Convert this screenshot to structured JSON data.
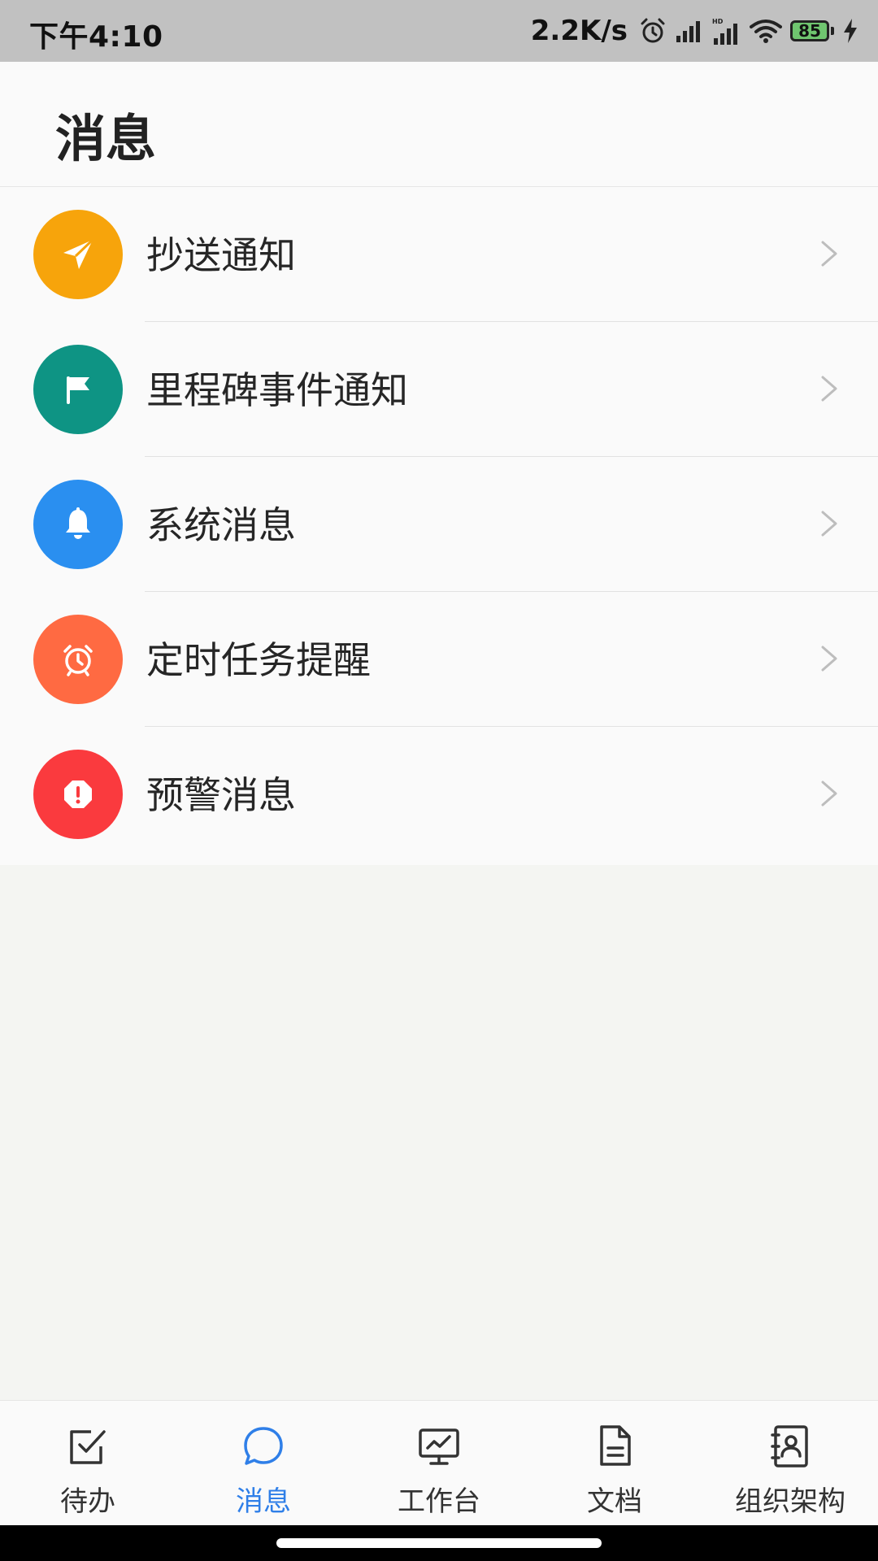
{
  "status_bar": {
    "time": "下午4:10",
    "net_speed": "2.2K/s",
    "battery_level": "85",
    "icons": [
      "alarm-icon",
      "signal-icon",
      "signal-hd-icon",
      "wifi-icon",
      "battery-icon",
      "charging-icon"
    ]
  },
  "header": {
    "title": "消息"
  },
  "list": {
    "items": [
      {
        "label": "抄送通知",
        "icon": "paper-plane-icon",
        "color": "#f7a40b"
      },
      {
        "label": "里程碑事件通知",
        "icon": "flag-icon",
        "color": "#0e9484"
      },
      {
        "label": "系统消息",
        "icon": "bell-icon",
        "color": "#2a8ff0"
      },
      {
        "label": "定时任务提醒",
        "icon": "alarm-clock-icon",
        "color": "#ff6a42"
      },
      {
        "label": "预警消息",
        "icon": "warning-octagon-icon",
        "color": "#fa3a3e"
      }
    ]
  },
  "bottom_nav": {
    "active_color": "#2f7fe8",
    "items": [
      {
        "label": "待办",
        "icon": "todo-check-icon",
        "active": false
      },
      {
        "label": "消息",
        "icon": "chat-bubble-icon",
        "active": true
      },
      {
        "label": "工作台",
        "icon": "monitor-chart-icon",
        "active": false
      },
      {
        "label": "文档",
        "icon": "document-icon",
        "active": false
      },
      {
        "label": "组织架构",
        "icon": "contact-book-icon",
        "active": false
      }
    ]
  }
}
